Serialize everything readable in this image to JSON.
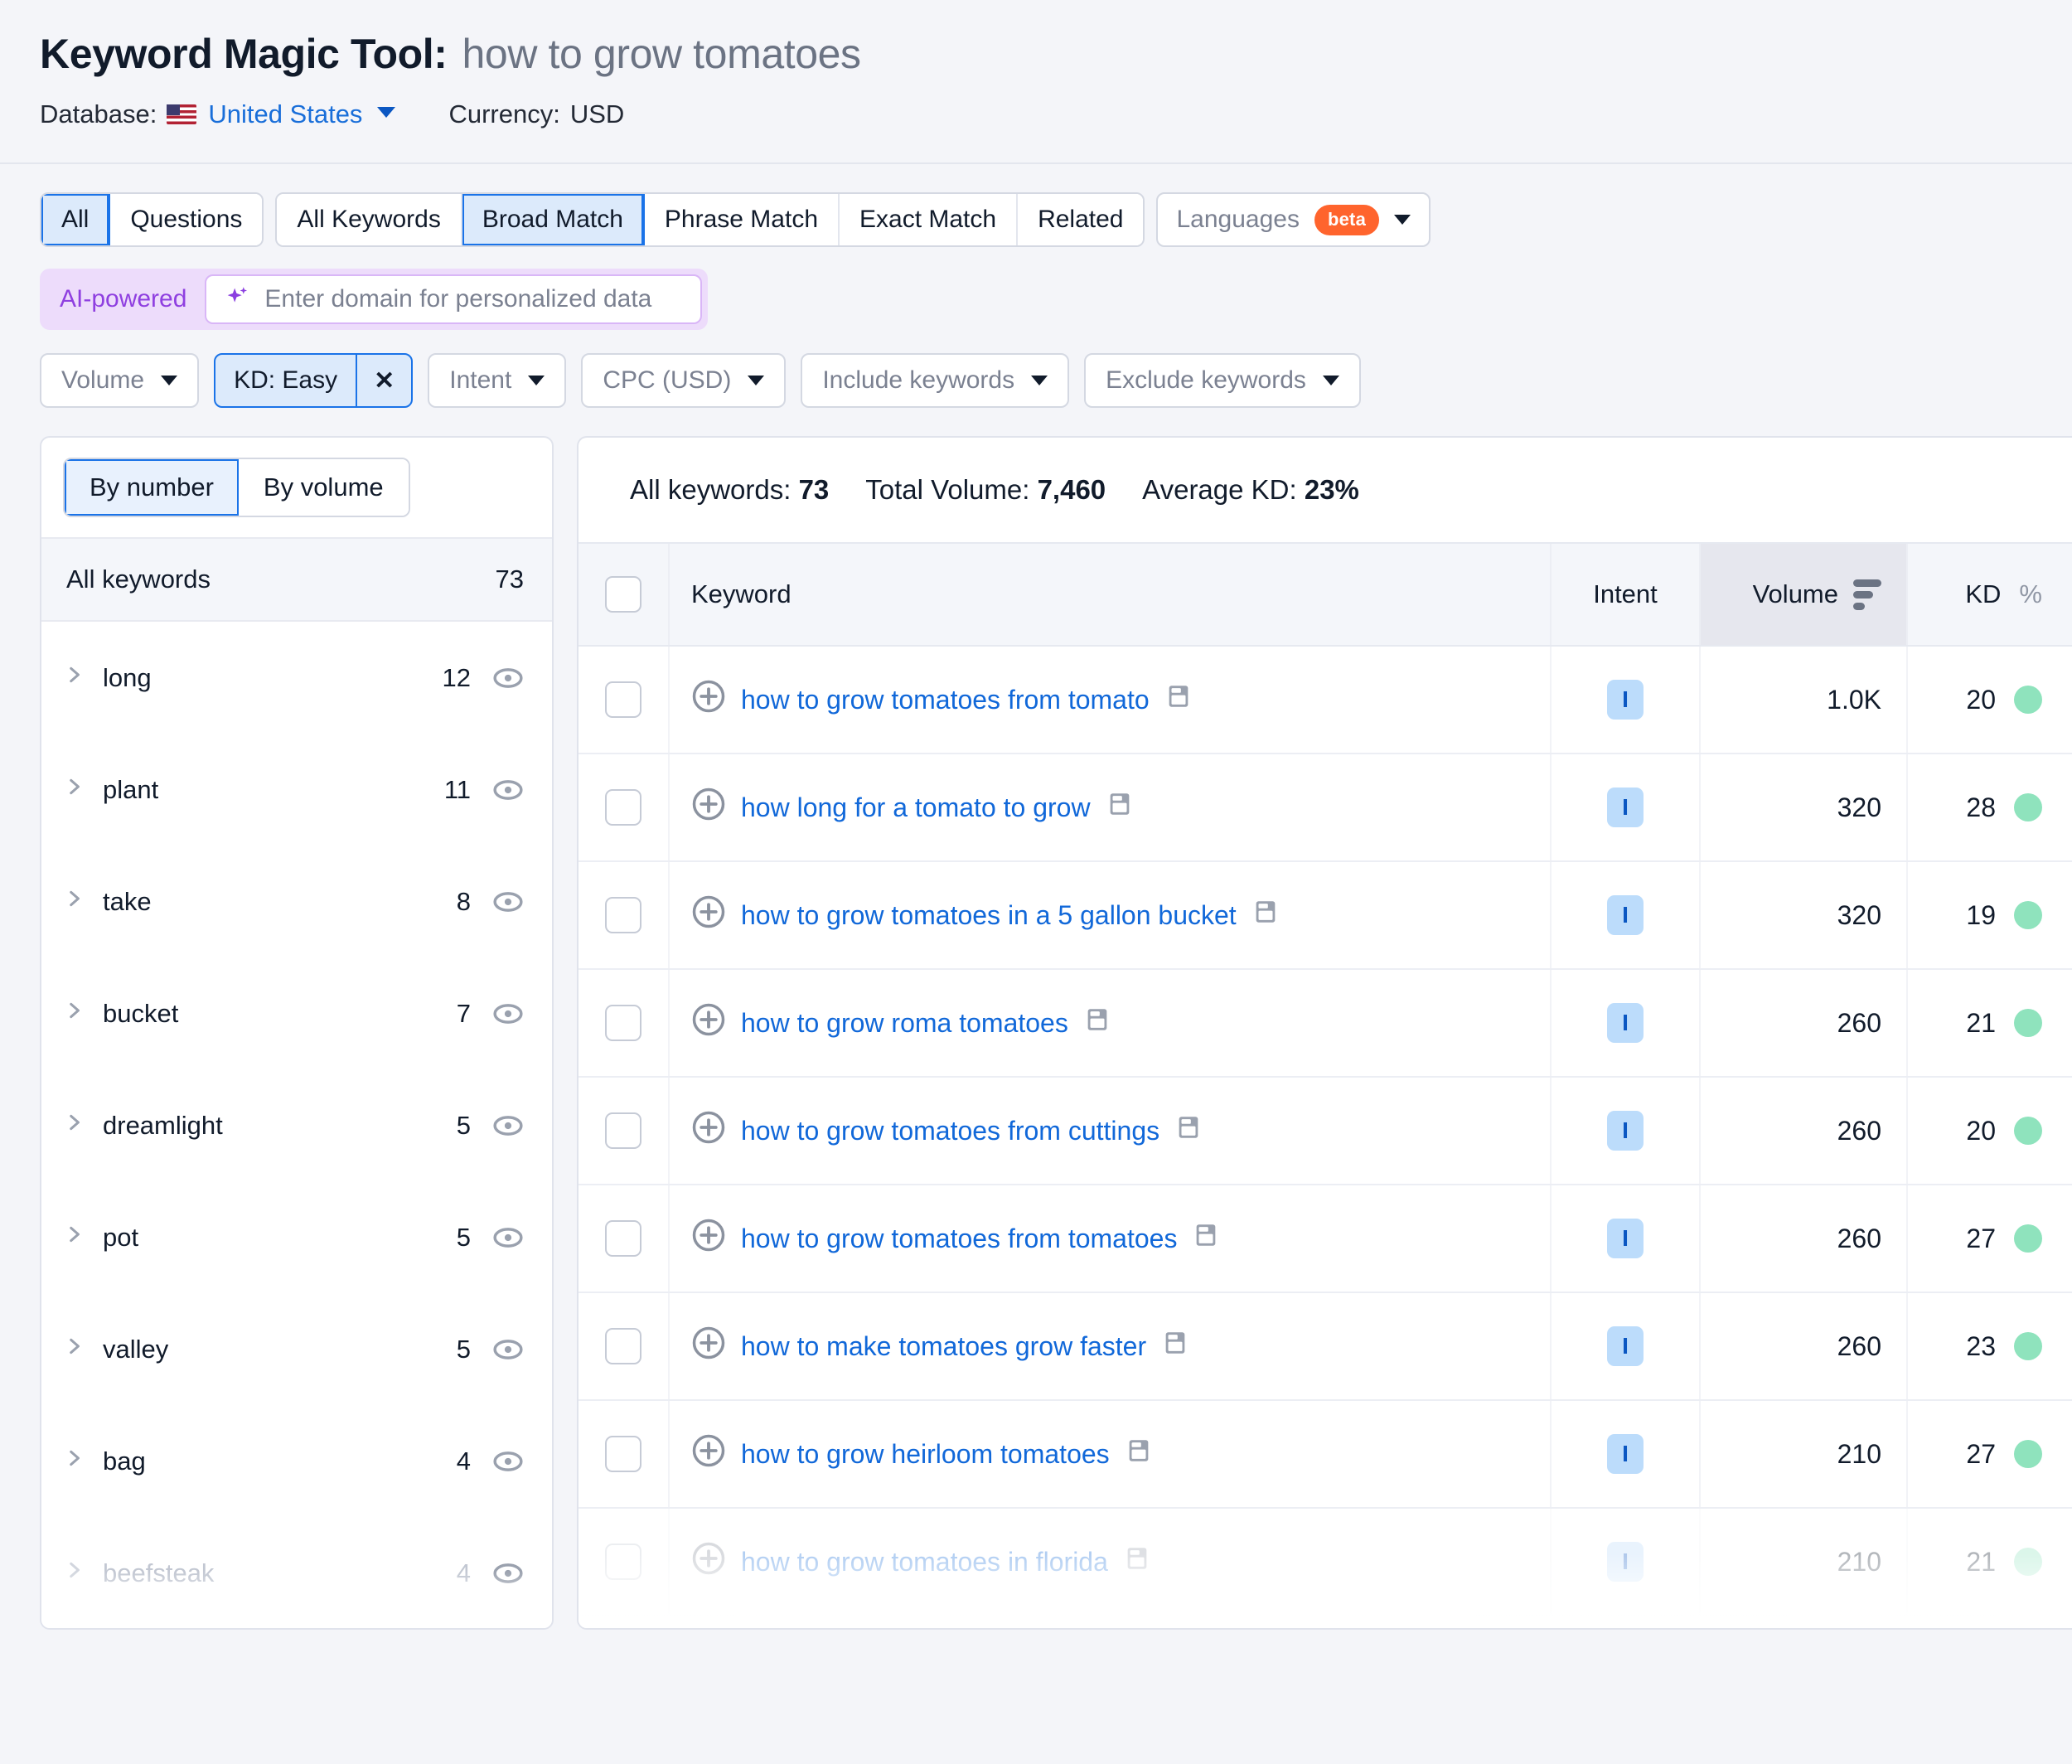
{
  "header": {
    "title_main": "Keyword Magic Tool:",
    "title_query": "how to grow tomatoes",
    "database_label": "Database:",
    "database_value": "United States",
    "currency_label": "Currency:",
    "currency_value": "USD"
  },
  "tabs": {
    "group1": [
      {
        "label": "All",
        "active": true
      },
      {
        "label": "Questions",
        "active": false
      }
    ],
    "group2": [
      {
        "label": "All Keywords",
        "active": false
      },
      {
        "label": "Broad Match",
        "active": true
      },
      {
        "label": "Phrase Match",
        "active": false
      },
      {
        "label": "Exact Match",
        "active": false
      },
      {
        "label": "Related",
        "active": false
      }
    ],
    "languages": {
      "label": "Languages",
      "badge": "beta"
    }
  },
  "ai_row": {
    "label": "AI-powered",
    "placeholder": "Enter domain for personalized data"
  },
  "filter_chips": [
    {
      "label": "Volume",
      "active": false
    },
    {
      "label": "KD: Easy",
      "active": true,
      "clear": "✕"
    },
    {
      "label": "Intent",
      "active": false
    },
    {
      "label": "CPC (USD)",
      "active": false
    },
    {
      "label": "Include keywords",
      "active": false
    },
    {
      "label": "Exclude keywords",
      "active": false
    }
  ],
  "sidebar": {
    "toggle": [
      {
        "label": "By number",
        "active": true
      },
      {
        "label": "By volume",
        "active": false
      }
    ],
    "all_keywords_label": "All keywords",
    "all_keywords_count": "73",
    "items": [
      {
        "label": "long",
        "count": "12"
      },
      {
        "label": "plant",
        "count": "11"
      },
      {
        "label": "take",
        "count": "8"
      },
      {
        "label": "bucket",
        "count": "7"
      },
      {
        "label": "dreamlight",
        "count": "5"
      },
      {
        "label": "pot",
        "count": "5"
      },
      {
        "label": "valley",
        "count": "5"
      },
      {
        "label": "bag",
        "count": "4"
      },
      {
        "label": "beefsteak",
        "count": "4",
        "faded": true
      }
    ]
  },
  "summary": {
    "all_keywords_label": "All keywords:",
    "all_keywords_value": "73",
    "total_volume_label": "Total Volume:",
    "total_volume_value": "7,460",
    "average_kd_label": "Average KD:",
    "average_kd_value": "23%"
  },
  "table": {
    "columns": {
      "keyword": "Keyword",
      "intent": "Intent",
      "volume": "Volume",
      "kd": "KD",
      "kd_pct": "%"
    },
    "rows": [
      {
        "keyword": "how to grow tomatoes from tomato",
        "intent": "I",
        "volume": "1.0K",
        "kd": "20"
      },
      {
        "keyword": "how long for a tomato to grow",
        "intent": "I",
        "volume": "320",
        "kd": "28"
      },
      {
        "keyword": "how to grow tomatoes in a 5 gallon bucket",
        "intent": "I",
        "volume": "320",
        "kd": "19"
      },
      {
        "keyword": "how to grow roma tomatoes",
        "intent": "I",
        "volume": "260",
        "kd": "21"
      },
      {
        "keyword": "how to grow tomatoes from cuttings",
        "intent": "I",
        "volume": "260",
        "kd": "20"
      },
      {
        "keyword": "how to grow tomatoes from tomatoes",
        "intent": "I",
        "volume": "260",
        "kd": "27"
      },
      {
        "keyword": "how to make tomatoes grow faster",
        "intent": "I",
        "volume": "260",
        "kd": "23"
      },
      {
        "keyword": "how to grow heirloom tomatoes",
        "intent": "I",
        "volume": "210",
        "kd": "27"
      },
      {
        "keyword": "how to grow tomatoes in florida",
        "intent": "I",
        "volume": "210",
        "kd": "21",
        "faded": true
      }
    ]
  },
  "colors": {
    "link": "#1168d9",
    "accent_blue": "#1a73e8",
    "active_tab_bg": "#dceafb",
    "ai_purple": "#8f3fe0",
    "beta_orange": "#ff642d",
    "kd_green": "#8fe3bd",
    "intent_badge_bg": "#bcdcfb"
  }
}
